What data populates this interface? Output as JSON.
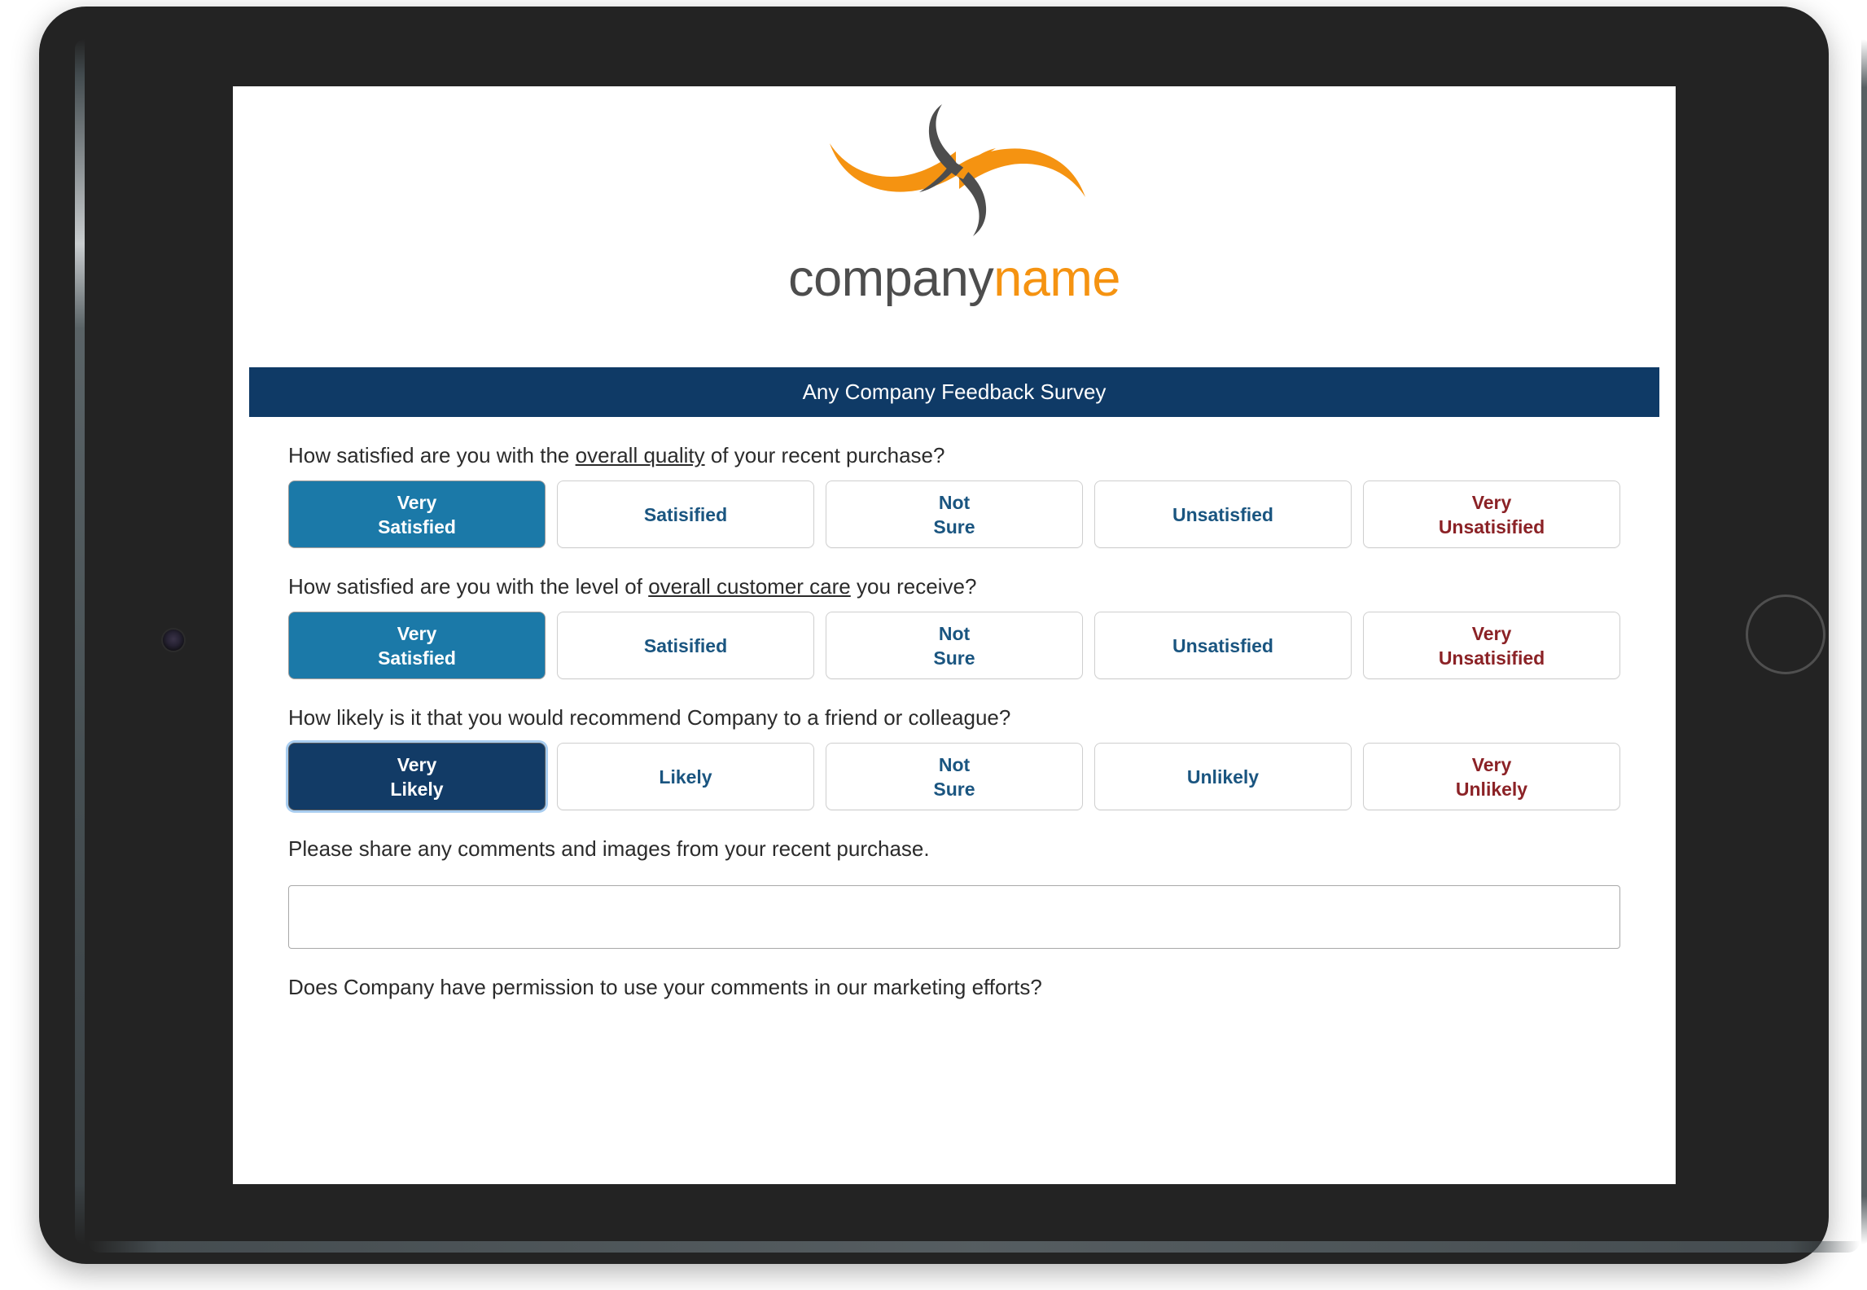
{
  "brand": {
    "wordmark_first": "company",
    "wordmark_second": "name",
    "logo_icon": "swirl-logo-icon",
    "orange": "#f59311",
    "dark_gray": "#4d4d4d"
  },
  "survey": {
    "title": "Any Company Feedback Survey",
    "title_bar_color": "#0f3a66",
    "questions": [
      {
        "id": "overall-quality",
        "text_before": "How satisfied are you with the ",
        "text_underlined": "overall quality",
        "text_after": " of your recent purchase?",
        "options": [
          {
            "line1": "Very",
            "line2": "Satisfied",
            "state": "selected-teal",
            "tone": "positive"
          },
          {
            "line1": "Satisified",
            "line2": "",
            "state": "unselected",
            "tone": "positive"
          },
          {
            "line1": "Not",
            "line2": "Sure",
            "state": "unselected",
            "tone": "neutral"
          },
          {
            "line1": "Unsatisfied",
            "line2": "",
            "state": "unselected",
            "tone": "positive"
          },
          {
            "line1": "Very",
            "line2": "Unsatisified",
            "state": "unselected",
            "tone": "negative"
          }
        ]
      },
      {
        "id": "customer-care",
        "text_before": "How satisfied are you with the level of ",
        "text_underlined": "overall customer care",
        "text_after": " you receive?",
        "options": [
          {
            "line1": "Very",
            "line2": "Satisfied",
            "state": "selected-teal",
            "tone": "positive"
          },
          {
            "line1": "Satisified",
            "line2": "",
            "state": "unselected",
            "tone": "positive"
          },
          {
            "line1": "Not",
            "line2": "Sure",
            "state": "unselected",
            "tone": "neutral"
          },
          {
            "line1": "Unsatisfied",
            "line2": "",
            "state": "unselected",
            "tone": "positive"
          },
          {
            "line1": "Very",
            "line2": "Unsatisified",
            "state": "unselected",
            "tone": "negative"
          }
        ]
      },
      {
        "id": "recommend",
        "text_before": "How likely is it that you would recommend Company to a friend or colleague?",
        "text_underlined": "",
        "text_after": "",
        "options": [
          {
            "line1": "Very",
            "line2": "Likely",
            "state": "selected-navy",
            "tone": "positive"
          },
          {
            "line1": "Likely",
            "line2": "",
            "state": "unselected",
            "tone": "positive"
          },
          {
            "line1": "Not",
            "line2": "Sure",
            "state": "unselected",
            "tone": "neutral"
          },
          {
            "line1": "Unlikely",
            "line2": "",
            "state": "unselected",
            "tone": "positive"
          },
          {
            "line1": "Very",
            "line2": "Unlikely",
            "state": "unselected",
            "tone": "negative"
          }
        ]
      }
    ],
    "comments": {
      "label": "Please share any comments and images from your recent purchase.",
      "value": "",
      "placeholder": ""
    },
    "permission_question": "Does Company have permission to use your comments in our marketing efforts?"
  },
  "device": {
    "camera_icon": "front-camera-icon",
    "home_button_icon": "home-button-icon"
  }
}
